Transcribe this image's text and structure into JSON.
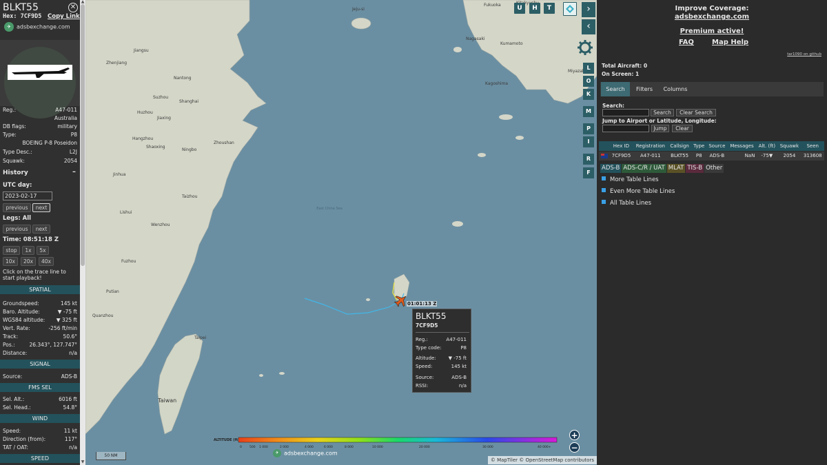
{
  "aircraft": {
    "callsign": "BLKT55",
    "hex_label": "Hex:",
    "hex": "7CF9D5",
    "copy_link": "Copy Link",
    "site": "adsbexchange.com",
    "reg_label": "Reg.:",
    "reg": "A47-011",
    "country": "Australia",
    "dbflags_label": "DB flags:",
    "dbflags": "military",
    "type_label": "Type:",
    "type": "P8",
    "type_full": "BOEING P-8 Poseidon",
    "typedesc_label": "Type Desc.:",
    "typedesc": "L2J",
    "squawk_label": "Squawk:",
    "squawk": "2054"
  },
  "history": {
    "title": "History",
    "collapse": "–",
    "utc_day_label": "UTC day:",
    "date": "2023-02-17",
    "prev": "previous",
    "next": "next",
    "legs_label": "Legs: All",
    "time_label": "Time: 08:51:18 Z",
    "speeds": [
      "stop",
      "1x",
      "5x",
      "10x",
      "20x",
      "40x"
    ],
    "hint": "Click on the trace line to start playback!"
  },
  "spatial": {
    "title": "SPATIAL",
    "rows": [
      {
        "k": "Groundspeed:",
        "v": "145 kt"
      },
      {
        "k": "Baro. Altitude:",
        "v": "▼ -75 ft"
      },
      {
        "k": "WGS84 altitude:",
        "v": "▼ 325 ft"
      },
      {
        "k": "Vert. Rate:",
        "v": "-256 ft/min"
      },
      {
        "k": "Track:",
        "v": "50.6°"
      },
      {
        "k": "Pos.:",
        "v": "26.343°, 127.747°"
      },
      {
        "k": "Distance:",
        "v": "n/a"
      }
    ]
  },
  "signal": {
    "title": "SIGNAL",
    "source_label": "Source:",
    "source": "ADS-B"
  },
  "fms": {
    "title": "FMS SEL",
    "rows": [
      {
        "k": "Sel. Alt.:",
        "v": "6016 ft"
      },
      {
        "k": "Sel. Head.:",
        "v": "54.8°"
      }
    ]
  },
  "wind": {
    "title": "WIND",
    "rows": [
      {
        "k": "Speed:",
        "v": "11 kt"
      },
      {
        "k": "Direction (from):",
        "v": "117°"
      },
      {
        "k": "TAT / OAT:",
        "v": "n/a"
      }
    ]
  },
  "speed_section": {
    "title": "SPEED"
  },
  "map": {
    "toolbar": [
      "U",
      "H",
      "T"
    ],
    "side_buttons": [
      "L",
      "O",
      "K",
      "M",
      "P",
      "I",
      "R",
      "F"
    ],
    "altitude_title": "ALTITUDE (ft)",
    "altitude_ticks": [
      "0",
      "500",
      "1 000",
      "2 000",
      "4 000",
      "6 000",
      "8 000",
      "10 000",
      "20 000",
      "30 000",
      "40 000+"
    ],
    "scale": "50 NM",
    "attribution": "© MapTiler © OpenStreetMap contributors",
    "brand": "adsbexchange.com",
    "plane_time": "01:01:13 Z",
    "labels": {
      "jeju": "Jeju-si",
      "fukuoka": "Fukuoka",
      "kitakyushu": "Kitakyushu",
      "nagasaki": "Nagasaki",
      "kumamoto": "Kumamoto",
      "miyazaki": "Miyazaki",
      "kagoshima": "Kagoshima",
      "nantong": "Nantong",
      "suzhou": "Suzhou",
      "shanghai": "Shanghai",
      "huzhou": "Huzhou",
      "jiaxing": "Jiaxing",
      "hangzhou": "Hangzhou",
      "shaoxing": "Shaoxing",
      "ningbo": "Ningbo",
      "zhoushan": "Zhoushan",
      "jinhua": "Jinhua",
      "taizhou": "Taizhou",
      "wenzhou": "Wenzhou",
      "lishui": "Lishui",
      "fuzhou": "Fuzhou",
      "putian": "Putian",
      "quanzhou": "Quanzhou",
      "taipei": "Taipei",
      "taiwan": "Taiwan",
      "east_china_sea": "East China Sea",
      "zhenjiang": "Zhenjiang",
      "jiangsu": "Jiangsu"
    }
  },
  "popup": {
    "callsign": "BLKT55",
    "hex": "7CF9D5",
    "rows": [
      {
        "k": "Reg.:",
        "v": "A47-011"
      },
      {
        "k": "Type code:",
        "v": "P8"
      },
      {
        "k": "Altitude:",
        "v": "▼ -75 ft"
      },
      {
        "k": "Speed:",
        "v": "145 kt"
      },
      {
        "k": "Source:",
        "v": "ADS-B"
      },
      {
        "k": "RSSI:",
        "v": "n/a"
      }
    ]
  },
  "right": {
    "improve": "Improve Coverage:",
    "improve_link": "adsbexchange.com",
    "premium": "Premium active!",
    "faq": "FAQ",
    "map_help": "Map Help",
    "github": "tar1090 on github",
    "total": "Total Aircraft: 0",
    "onscreen": "On Screen: 1",
    "tabs": [
      "Search",
      "Filters",
      "Columns"
    ],
    "search_label": "Search:",
    "search_btn": "Search",
    "clear_search": "Clear Search",
    "jump_label": "Jump to Airport or Latitude, Longitude:",
    "jump_btn": "Jump",
    "clear_btn": "Clear",
    "columns": [
      "",
      "Hex ID",
      "Registration",
      "Callsign",
      "Type",
      "Source",
      "Messages",
      "Alt. (ft)",
      "Squawk",
      "Seen"
    ],
    "row": [
      "7CF9D5",
      "A47-011",
      "BLKT55",
      "P8",
      "ADS-B",
      "NaN",
      "-75▼",
      "2054",
      "313608"
    ],
    "sources": [
      "ADS-B",
      "ADS-C/R / UAT",
      "MLAT",
      "TIS-B",
      "Other"
    ],
    "more": "More Table Lines",
    "even_more": "Even More Table Lines",
    "all": "All Table Lines"
  },
  "colors": {
    "accent": "#23525c",
    "button": "#2c5e66",
    "sea": "#6b8fa2",
    "land": "#d4d6c8",
    "trail": "#41b6e8",
    "plane": "#e05a1a"
  }
}
